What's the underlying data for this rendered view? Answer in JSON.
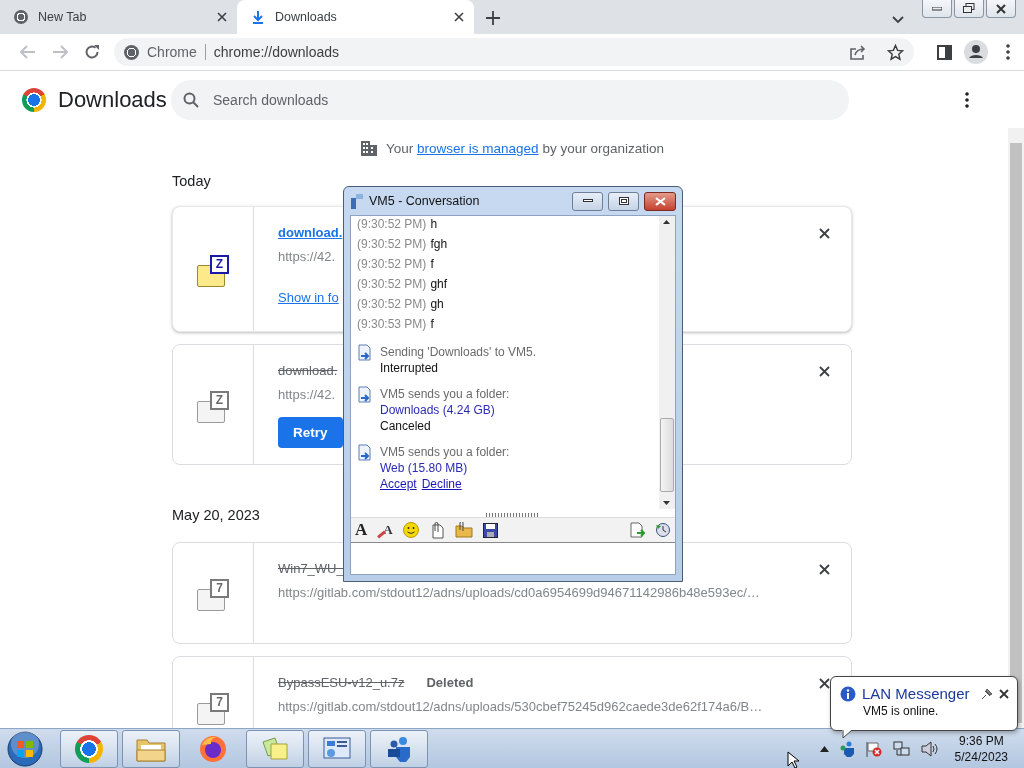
{
  "browser_tabs": [
    {
      "kind": "newtab",
      "title": "New Tab",
      "selected": false
    },
    {
      "kind": "downloads",
      "title": "Downloads",
      "selected": true
    }
  ],
  "omnibox": {
    "site_label": "Chrome",
    "url": "chrome://downloads"
  },
  "page": {
    "title": "Downloads",
    "search_placeholder": "Search downloads"
  },
  "managed_notice": {
    "before": "Your ",
    "link": "browser is managed",
    "after": " by your organization"
  },
  "groups": [
    {
      "date": "Today",
      "items": [
        {
          "kind": "complete",
          "icon_glyph": "Z",
          "name": "download.",
          "url": "https://42.",
          "action": "Show in fo"
        },
        {
          "kind": "failed",
          "icon_glyph": "Z",
          "name": "download.",
          "url": "https://42.",
          "action": "Retry"
        }
      ]
    },
    {
      "date": "May 20, 2023",
      "items": [
        {
          "kind": "removed",
          "icon_glyph": "7",
          "name": "Win7_WU_",
          "url": "https://gitlab.com/stdout12/adns/uploads/cd0a6954699d94671142986b48e593ec/…"
        },
        {
          "kind": "removed",
          "icon_glyph": "7",
          "name": "BypassESU-v12_u.7z",
          "status": "Deleted",
          "url": "https://gitlab.com/stdout12/adns/uploads/530cbef75245d962caede3de62f174a6/B…"
        }
      ]
    }
  ],
  "chat_window": {
    "title": "VM5 - Conversation",
    "messages": [
      {
        "kind": "chat",
        "time": "(9:30:52 PM)",
        "text": "h"
      },
      {
        "kind": "chat",
        "time": "(9:30:52 PM)",
        "text": "fgh"
      },
      {
        "kind": "chat",
        "time": "(9:30:52 PM)",
        "text": "f"
      },
      {
        "kind": "chat",
        "time": "(9:30:52 PM)",
        "text": "ghf"
      },
      {
        "kind": "chat",
        "time": "(9:30:52 PM)",
        "text": "gh"
      },
      {
        "kind": "chat",
        "time": "(9:30:53 PM)",
        "text": "f"
      },
      {
        "kind": "transfer",
        "line": "Sending 'Downloads' to VM5.",
        "status": "Interrupted"
      },
      {
        "kind": "transfer",
        "line": "VM5 sends you a folder:",
        "link": "Downloads (4.24 GB)",
        "status": "Canceled"
      },
      {
        "kind": "transfer",
        "line": "VM5 sends you a folder:",
        "link": "Web (15.80 MB)",
        "actions": [
          "Accept",
          "Decline"
        ]
      }
    ],
    "toolbar": [
      {
        "kind": "font",
        "label": "A"
      },
      {
        "kind": "font_color",
        "label": "A"
      },
      {
        "kind": "emoji"
      },
      {
        "kind": "attach_file"
      },
      {
        "kind": "attach_folder"
      },
      {
        "kind": "save"
      }
    ]
  },
  "taskbar": {
    "apps": [
      {
        "kind": "chrome",
        "running": true
      },
      {
        "kind": "explorer",
        "running": true
      },
      {
        "kind": "firefox",
        "running": false
      },
      {
        "kind": "notes",
        "running": true
      },
      {
        "kind": "panel",
        "running": true
      },
      {
        "kind": "messenger",
        "running": true
      }
    ],
    "time": "9:36 PM",
    "date": "5/24/2023"
  },
  "balloon": {
    "title": "LAN Messenger",
    "text": "VM5 is online."
  }
}
